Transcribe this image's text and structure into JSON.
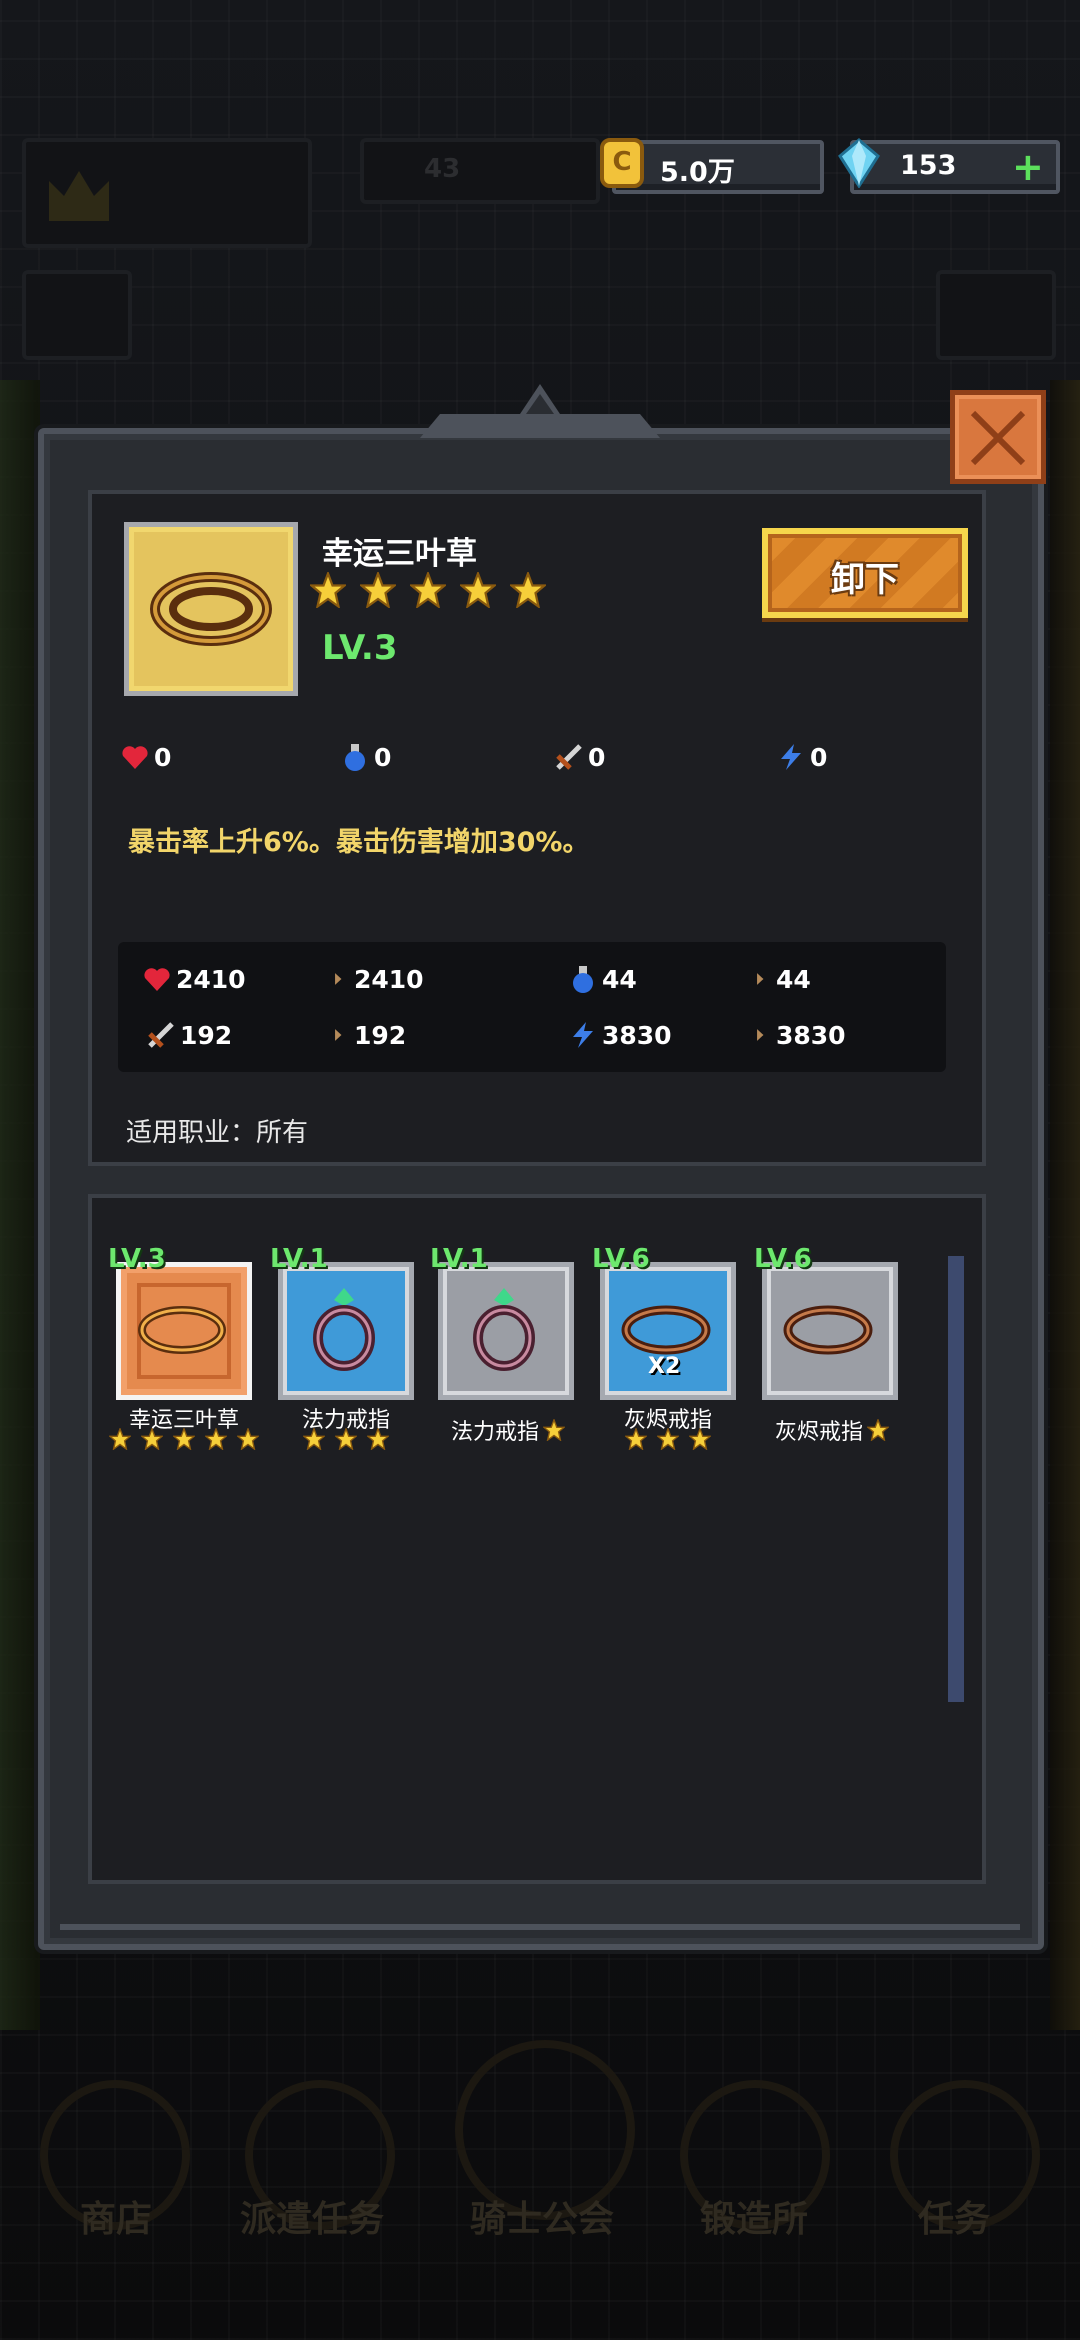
{
  "top_bar": {
    "gold": {
      "icon": "coin-icon",
      "value": "5.0万"
    },
    "gems": {
      "icon": "diamond-icon",
      "value": "153",
      "add_label": "+"
    },
    "background_level": "43"
  },
  "item_detail": {
    "name": "幸运三叶草",
    "stars": 5,
    "level": "LV.3",
    "unequip_label": "卸下",
    "base_stats": [
      {
        "icon": "heart-icon",
        "value": "0"
      },
      {
        "icon": "mana-potion-icon",
        "value": "0"
      },
      {
        "icon": "sword-icon",
        "value": "0"
      },
      {
        "icon": "lightning-icon",
        "value": "0"
      }
    ],
    "description": "暴击率上升6%。暴击伤害增加30%。",
    "comparison_stats": [
      {
        "icon": "heart-icon",
        "value": "2410"
      },
      {
        "icon": "arrow-icon",
        "value": "2410"
      },
      {
        "icon": "mana-potion-icon",
        "value": "44"
      },
      {
        "icon": "arrow-icon",
        "value": "44"
      },
      {
        "icon": "sword-icon",
        "value": "192"
      },
      {
        "icon": "arrow-icon",
        "value": "192"
      },
      {
        "icon": "lightning-icon",
        "value": "3830"
      },
      {
        "icon": "arrow-icon",
        "value": "3830"
      }
    ],
    "job_label": "适用职业：所有"
  },
  "inventory": [
    {
      "level": "LV.3",
      "name": "幸运三叶草",
      "stars": 5,
      "rarity_color": "#e58a4e",
      "icon": "gold-ring-icon",
      "selected": true
    },
    {
      "level": "LV.1",
      "name": "法力戒指",
      "stars": 3,
      "rarity_color": "#3f9ad8",
      "icon": "gem-ring-icon"
    },
    {
      "level": "LV.1",
      "name": "法力戒指",
      "stars": 1,
      "rarity_color": "#9b9ea5",
      "icon": "gem-ring-icon"
    },
    {
      "level": "LV.6",
      "name": "灰烬戒指",
      "stars": 3,
      "rarity_color": "#3f9ad8",
      "icon": "ember-ring-icon",
      "count": "X2"
    },
    {
      "level": "LV.6",
      "name": "灰烬戒指",
      "stars": 1,
      "rarity_color": "#9b9ea5",
      "icon": "ember-ring-icon"
    }
  ],
  "bottom_nav": [
    "商店",
    "派遣任务",
    "骑士公会",
    "锻造所",
    "任务"
  ],
  "colors": {
    "level_green": "#6de86e",
    "desc_gold": "#f2d56a",
    "button_orange": "#e08a2c"
  }
}
